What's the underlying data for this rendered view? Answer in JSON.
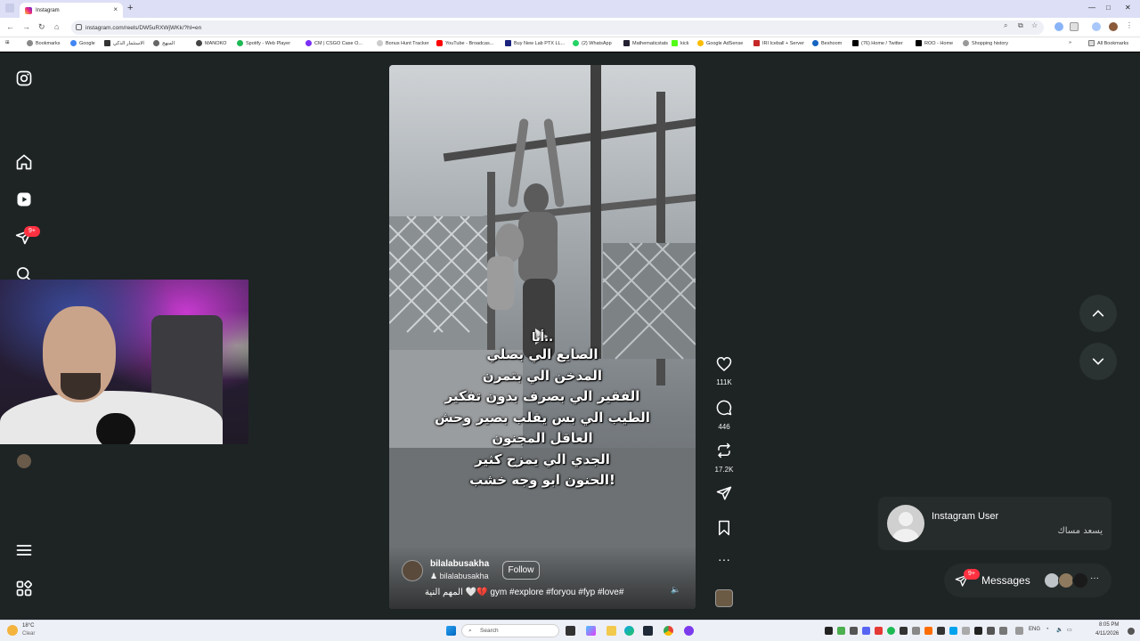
{
  "browser": {
    "tab_title": "Instagram",
    "tab_close": "×",
    "new_tab": "+",
    "url": "instagram.com/reels/DW5uRXWjWKk/?hl=en",
    "back": "←",
    "forward": "→",
    "reload": "↻",
    "home": "⌂",
    "win_min": "—",
    "win_max": "□",
    "win_close": "✕",
    "all_bookmarks": "All Bookmarks",
    "bookmarks": [
      "Bookmarks",
      "Google",
      "الاستثمار الذكي",
      "المنهج",
      "MANOKO",
      "Spotify - Web Player",
      "CM | CSGO Case O...",
      "Bonus Hunt Tracker",
      "YouTube - Broadcas...",
      "Buy New Lab PTX LL...",
      "(2) WhatsApp",
      "Mathematicstats",
      "kick",
      "Google AdSense",
      "IRI Iceball + Server",
      "Beshoom",
      "(76) Home / Twitter",
      "ROO - Home",
      "Shopping history"
    ]
  },
  "instagram": {
    "notification_badge": "9+",
    "reel": {
      "caption_lines": [
        "أنا..",
        "الصايع الي بصلي",
        "المدخن الي بتمرن",
        "الفقير الي بصرف بدون تفكير",
        "الطيب الي بس يقلب بصير وحش",
        "العاقل المجنون",
        "الجدي الي يمزح كثير",
        "الحنون ابو وجه خشب!"
      ],
      "author": "bilalabusakha",
      "author_sub": "bilalabusakha",
      "follow_label": "Follow",
      "description": "المهم النية 🤍💔 gym #explore #foryou #fyp #love#"
    },
    "actions": {
      "likes": "111K",
      "comments": "446",
      "reposts": "17.2K"
    },
    "notification": {
      "title": "Instagram User",
      "message": "يسعد مساك"
    },
    "messages": {
      "label": "Messages",
      "badge": "9+"
    }
  },
  "taskbar": {
    "weather_temp": "18°C",
    "weather_cond": "Clear",
    "search_placeholder": "Search",
    "lang": "ENG",
    "time": "8:05 PM",
    "date": "4/11/2026"
  }
}
